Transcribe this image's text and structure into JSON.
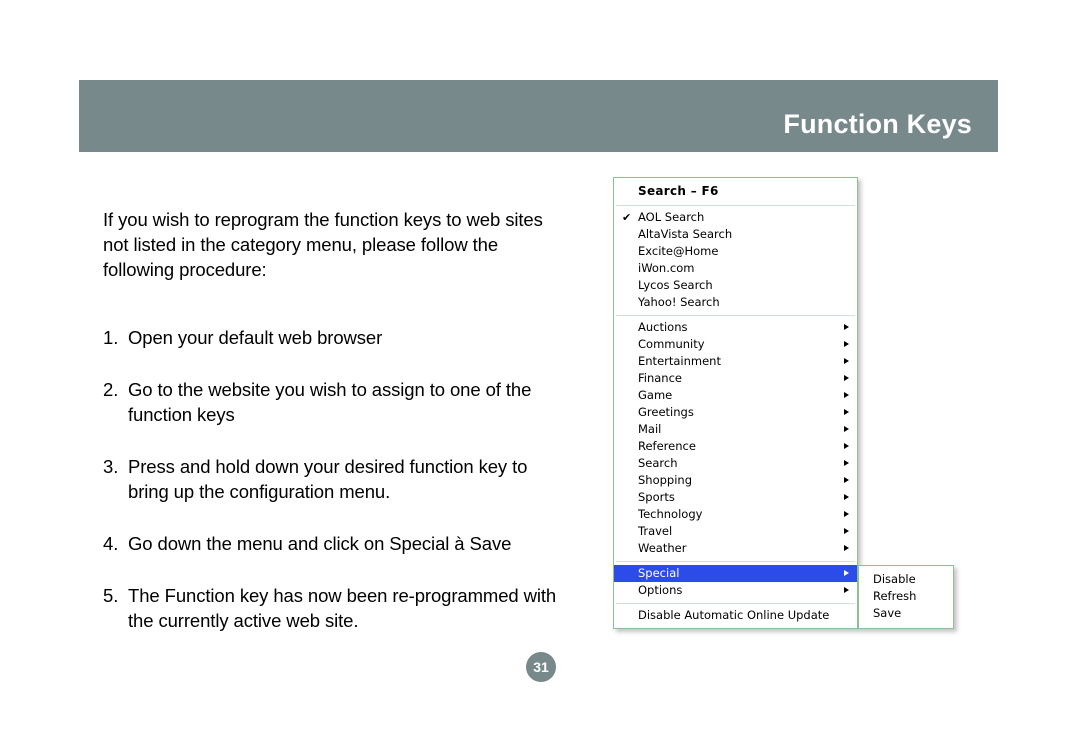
{
  "header": {
    "title": "Function Keys"
  },
  "page_number": "31",
  "body": {
    "intro": "If you wish to reprogram the function keys to web sites not listed in the category menu, please follow the following procedure:",
    "steps": [
      {
        "num": "1.",
        "text": "Open your default web browser"
      },
      {
        "num": "2.",
        "text": "Go to the website you wish to assign to one of the function keys"
      },
      {
        "num": "3.",
        "text": "Press and hold down your desired function key to bring up the configuration menu."
      },
      {
        "num": "4.",
        "text": "Go down the menu and click on Special à Save"
      },
      {
        "num": "5.",
        "text": "The Function key has now been re-programmed with the currently active web site."
      }
    ]
  },
  "context_menu": {
    "header": "Search – F6",
    "search_engines": [
      {
        "label": "AOL Search",
        "checked": true
      },
      {
        "label": "AltaVista Search",
        "checked": false
      },
      {
        "label": "Excite@Home",
        "checked": false
      },
      {
        "label": "iWon.com",
        "checked": false
      },
      {
        "label": "Lycos Search",
        "checked": false
      },
      {
        "label": "Yahoo! Search",
        "checked": false
      }
    ],
    "categories": [
      "Auctions",
      "Community",
      "Entertainment",
      "Finance",
      "Game",
      "Greetings",
      "Mail",
      "Reference",
      "Search",
      "Shopping",
      "Sports",
      "Technology",
      "Travel",
      "Weather"
    ],
    "special_items": [
      {
        "label": "Special",
        "highlighted": true,
        "submenu": true
      },
      {
        "label": "Options",
        "highlighted": false,
        "submenu": true
      }
    ],
    "footer_item": "Disable Automatic Online Update",
    "check_glyph": "✔",
    "highlight_color": "#2b4ce8",
    "border_color": "#8fbf97"
  },
  "submenu": {
    "items": [
      "Disable",
      "Refresh",
      "Save"
    ]
  },
  "colors": {
    "header_bar": "#78898c",
    "badge": "#78898c",
    "page_background": "#ffffff"
  }
}
